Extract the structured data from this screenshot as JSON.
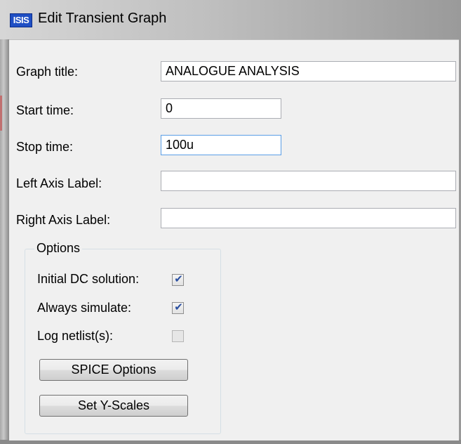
{
  "window": {
    "icon_text": "ISIS",
    "title": "Edit Transient Graph"
  },
  "fields": {
    "graph_title": {
      "label": "Graph title:",
      "value": "ANALOGUE ANALYSIS"
    },
    "start_time": {
      "label": "Start time:",
      "value": "0"
    },
    "stop_time": {
      "label": "Stop time:",
      "value": "100u"
    },
    "left_axis_label": {
      "label": "Left Axis Label:",
      "value": ""
    },
    "right_axis_label": {
      "label": "Right Axis Label:",
      "value": ""
    }
  },
  "options": {
    "group_title": "Options",
    "initial_dc": {
      "label": "Initial DC solution:",
      "checked": true
    },
    "always_simulate": {
      "label": "Always simulate:",
      "checked": true
    },
    "log_netlists": {
      "label": "Log netlist(s):",
      "checked": false
    }
  },
  "buttons": {
    "spice_options": "SPICE Options",
    "set_y_scales": "Set Y-Scales"
  },
  "colors": {
    "check_mark": "#2a4fa0",
    "focus_border": "#5b9ee6",
    "icon_background": "#1f4fc4"
  }
}
